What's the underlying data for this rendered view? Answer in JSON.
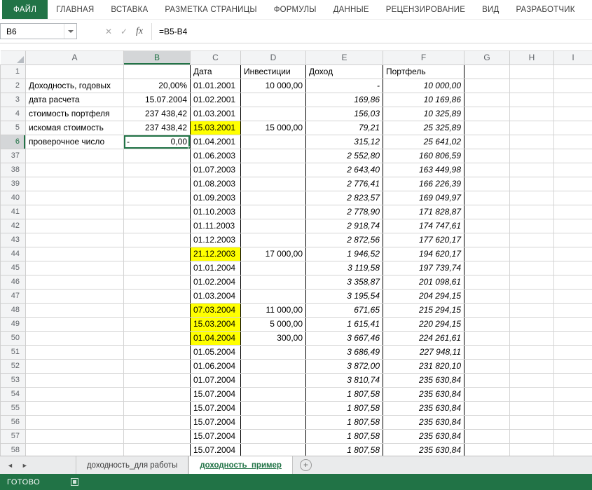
{
  "ribbon": {
    "file_tab": "ФАЙЛ",
    "tabs": [
      "ГЛАВНАЯ",
      "ВСТАВКА",
      "РАЗМЕТКА СТРАНИЦЫ",
      "ФОРМУЛЫ",
      "ДАННЫЕ",
      "РЕЦЕНЗИРОВАНИЕ",
      "ВИД",
      "РАЗРАБОТЧИК"
    ]
  },
  "formula_bar": {
    "name_box": "B6",
    "cancel_glyph": "✕",
    "enter_glyph": "✓",
    "fx_label": "fx",
    "formula": "=B5-B4"
  },
  "grid": {
    "columns": [
      "A",
      "B",
      "C",
      "D",
      "E",
      "F",
      "G",
      "H",
      "I"
    ],
    "selected_column": "B",
    "selected_row": "6",
    "selected_cell": "B6",
    "rows": [
      {
        "n": "1",
        "plain": true,
        "C": "Дата",
        "D": "Инвестиции",
        "E": "Доход",
        "F": "Портфель"
      },
      {
        "n": "2",
        "A": "Доходность, годовых",
        "B": "20,00%",
        "C": "01.01.2001",
        "D": "10 000,00",
        "E": "-",
        "F": "10 000,00"
      },
      {
        "n": "3",
        "A": "дата расчета",
        "B": "15.07.2004",
        "C": "01.02.2001",
        "E": "169,86",
        "F": "10 169,86"
      },
      {
        "n": "4",
        "A": "стоимость портфеля",
        "B": "237 438,42",
        "C": "01.03.2001",
        "E": "156,03",
        "F": "10 325,89"
      },
      {
        "n": "5",
        "A": "искомая стоимость",
        "B": "237 438,42",
        "C": "15.03.2001",
        "yellow": [
          "C"
        ],
        "D": "15 000,00",
        "E": "79,21",
        "F": "25 325,89"
      },
      {
        "n": "6",
        "A": "проверочное число",
        "B": "0,00",
        "B_prefix": "-",
        "C": "01.04.2001",
        "E": "315,12",
        "F": "25 641,02"
      },
      {
        "n": "37",
        "C": "01.06.2003",
        "E": "2 552,80",
        "F": "160 806,59"
      },
      {
        "n": "38",
        "C": "01.07.2003",
        "E": "2 643,40",
        "F": "163 449,98"
      },
      {
        "n": "39",
        "C": "01.08.2003",
        "E": "2 776,41",
        "F": "166 226,39"
      },
      {
        "n": "40",
        "C": "01.09.2003",
        "E": "2 823,57",
        "F": "169 049,97"
      },
      {
        "n": "41",
        "C": "01.10.2003",
        "E": "2 778,90",
        "F": "171 828,87"
      },
      {
        "n": "42",
        "C": "01.11.2003",
        "E": "2 918,74",
        "F": "174 747,61"
      },
      {
        "n": "43",
        "C": "01.12.2003",
        "E": "2 872,56",
        "F": "177 620,17"
      },
      {
        "n": "44",
        "C": "21.12.2003",
        "yellow": [
          "C"
        ],
        "D": "17 000,00",
        "E": "1 946,52",
        "F": "194 620,17"
      },
      {
        "n": "45",
        "C": "01.01.2004",
        "E": "3 119,58",
        "F": "197 739,74"
      },
      {
        "n": "46",
        "C": "01.02.2004",
        "E": "3 358,87",
        "F": "201 098,61"
      },
      {
        "n": "47",
        "C": "01.03.2004",
        "E": "3 195,54",
        "F": "204 294,15"
      },
      {
        "n": "48",
        "C": "07.03.2004",
        "yellow": [
          "C"
        ],
        "D": "11 000,00",
        "E": "671,65",
        "F": "215 294,15"
      },
      {
        "n": "49",
        "C": "15.03.2004",
        "yellow": [
          "C"
        ],
        "D": "5 000,00",
        "E": "1 615,41",
        "F": "220 294,15"
      },
      {
        "n": "50",
        "C": "01.04.2004",
        "yellow": [
          "C"
        ],
        "D": "300,00",
        "E": "3 667,46",
        "F": "224 261,61"
      },
      {
        "n": "51",
        "C": "01.05.2004",
        "E": "3 686,49",
        "F": "227 948,11"
      },
      {
        "n": "52",
        "C": "01.06.2004",
        "E": "3 872,00",
        "F": "231 820,10"
      },
      {
        "n": "53",
        "C": "01.07.2004",
        "E": "3 810,74",
        "F": "235 630,84"
      },
      {
        "n": "54",
        "C": "15.07.2004",
        "E": "1 807,58",
        "F": "235 630,84"
      },
      {
        "n": "55",
        "C": "15.07.2004",
        "E": "1 807,58",
        "F": "235 630,84"
      },
      {
        "n": "56",
        "C": "15.07.2004",
        "E": "1 807,58",
        "F": "235 630,84"
      },
      {
        "n": "57",
        "C": "15.07.2004",
        "E": "1 807,58",
        "F": "235 630,84"
      },
      {
        "n": "58",
        "C": "15.07.2004",
        "E": "1 807,58",
        "F": "235 630,84"
      }
    ]
  },
  "sheet_bar": {
    "nav_left_glyph": "◄",
    "nav_right_glyph": "►",
    "tabs": [
      {
        "label": "доходность_для работы",
        "active": false
      },
      {
        "label": "доходность_пример",
        "active": true
      }
    ],
    "add_glyph": "+"
  },
  "status_bar": {
    "mode": "ГОТОВО"
  },
  "colors": {
    "accent_green": "#217346",
    "highlight_yellow": "#ffff00"
  }
}
